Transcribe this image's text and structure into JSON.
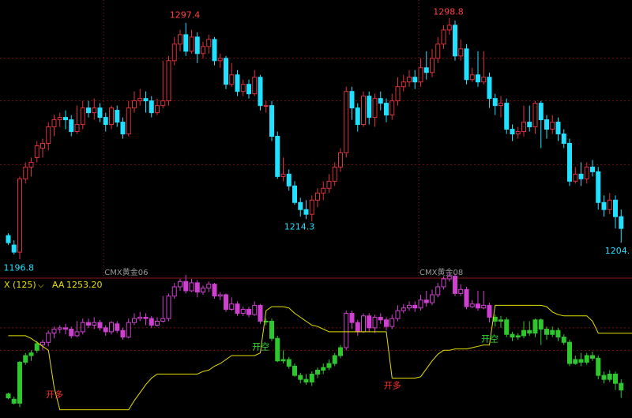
{
  "colors": {
    "background": "#000000",
    "up": "#e0303a",
    "down": "#22e0ff",
    "grid": "#7a1010",
    "separator": "#8b1a1a",
    "band_line": "#e6e000",
    "band_up": "#d040d0",
    "band_down": "#2ec82e",
    "label_high": "#ff4040",
    "label_low": "#22e0ff",
    "signal_long": "#2ee02e",
    "signal_short": "#ff3030",
    "indicator_title": "#e6e000"
  },
  "main": {
    "contract_labels": [
      {
        "text": "CMX黄金06",
        "index": 17
      },
      {
        "text": "CMX黄金08",
        "index": 72
      }
    ],
    "price_labels": [
      {
        "text": "1297.4",
        "index": 31,
        "price": 1297.4,
        "kind": "high"
      },
      {
        "text": "1214.3",
        "index": 51,
        "price": 1214.3,
        "kind": "low"
      },
      {
        "text": "1298.8",
        "index": 77,
        "price": 1298.8,
        "kind": "high"
      },
      {
        "text": "1196.8",
        "index": 2,
        "price": 1196.8,
        "kind": "low-left"
      },
      {
        "text": "1204.",
        "index": 107,
        "price": 1204.0,
        "kind": "low"
      }
    ]
  },
  "indicator": {
    "name": "X (125)",
    "line_label": "AA",
    "line_value": "1253.20",
    "signals": [
      {
        "text": "开空",
        "index": 44,
        "kind": "short"
      },
      {
        "text": "开多",
        "index": 67,
        "kind": "long"
      },
      {
        "text": "开空",
        "index": 84,
        "kind": "short"
      },
      {
        "text": "开多",
        "index": 8,
        "kind": "long"
      }
    ]
  },
  "chart_data": {
    "type": "candlestick",
    "ylim_price": [
      1192,
      1304
    ],
    "ylim_indicator": [
      1190,
      1285
    ],
    "gridlines_price": [
      1282,
      1264,
      1237
    ],
    "gridlines_indicator": [
      1257,
      1240
    ],
    "candles": [
      [
        1207,
        1204,
        1208,
        1203
      ],
      [
        1203,
        1200,
        1205,
        1199
      ],
      [
        1200,
        1231,
        1232,
        1197
      ],
      [
        1231,
        1236,
        1238,
        1229
      ],
      [
        1236,
        1238,
        1240,
        1232
      ],
      [
        1240,
        1245,
        1247,
        1238
      ],
      [
        1244,
        1246,
        1248,
        1240
      ],
      [
        1246,
        1253,
        1255,
        1243
      ],
      [
        1253,
        1256,
        1258,
        1249
      ],
      [
        1256,
        1257,
        1259,
        1253
      ],
      [
        1257,
        1256,
        1260,
        1252
      ],
      [
        1256,
        1251,
        1258,
        1249
      ],
      [
        1251,
        1254,
        1262,
        1250
      ],
      [
        1254,
        1261,
        1264,
        1252
      ],
      [
        1261,
        1259,
        1264,
        1257
      ],
      [
        1259,
        1261,
        1265,
        1256
      ],
      [
        1261,
        1257,
        1263,
        1255
      ],
      [
        1257,
        1254,
        1259,
        1251
      ],
      [
        1254,
        1261,
        1262,
        1252
      ],
      [
        1260,
        1255,
        1262,
        1253
      ],
      [
        1255,
        1250,
        1257,
        1248
      ],
      [
        1250,
        1261,
        1264,
        1249
      ],
      [
        1261,
        1264,
        1268,
        1259
      ],
      [
        1264,
        1265,
        1269,
        1262
      ],
      [
        1265,
        1264,
        1268,
        1259
      ],
      [
        1264,
        1259,
        1266,
        1257
      ],
      [
        1259,
        1262,
        1265,
        1258
      ],
      [
        1262,
        1264,
        1281,
        1261
      ],
      [
        1264,
        1281,
        1283,
        1262
      ],
      [
        1281,
        1288,
        1291,
        1279
      ],
      [
        1288,
        1292,
        1294,
        1285
      ],
      [
        1292,
        1285,
        1297,
        1283
      ],
      [
        1285,
        1291,
        1294,
        1284
      ],
      [
        1291,
        1284,
        1293,
        1280
      ],
      [
        1284,
        1287,
        1289,
        1282
      ],
      [
        1287,
        1290,
        1292,
        1284
      ],
      [
        1290,
        1281,
        1291,
        1279
      ],
      [
        1281,
        1282,
        1284,
        1278
      ],
      [
        1282,
        1271,
        1283,
        1269
      ],
      [
        1271,
        1275,
        1280,
        1270
      ],
      [
        1275,
        1268,
        1277,
        1266
      ],
      [
        1268,
        1271,
        1273,
        1266
      ],
      [
        1271,
        1267,
        1273,
        1265
      ],
      [
        1267,
        1274,
        1277,
        1266
      ],
      [
        1274,
        1262,
        1275,
        1260
      ],
      [
        1262,
        1262,
        1264,
        1259
      ],
      [
        1262,
        1249,
        1264,
        1247
      ],
      [
        1249,
        1232,
        1251,
        1231
      ],
      [
        1232,
        1233,
        1240,
        1230
      ],
      [
        1233,
        1228,
        1235,
        1226
      ],
      [
        1228,
        1221,
        1230,
        1220
      ],
      [
        1221,
        1218,
        1223,
        1215
      ],
      [
        1218,
        1216,
        1222,
        1214
      ],
      [
        1216,
        1222,
        1224,
        1213
      ],
      [
        1222,
        1225,
        1227,
        1219
      ],
      [
        1225,
        1227,
        1230,
        1222
      ],
      [
        1227,
        1230,
        1233,
        1225
      ],
      [
        1230,
        1236,
        1238,
        1228
      ],
      [
        1236,
        1242,
        1244,
        1234
      ],
      [
        1242,
        1268,
        1270,
        1240
      ],
      [
        1268,
        1261,
        1270,
        1256
      ],
      [
        1261,
        1254,
        1263,
        1251
      ],
      [
        1254,
        1266,
        1268,
        1253
      ],
      [
        1266,
        1257,
        1268,
        1254
      ],
      [
        1257,
        1265,
        1267,
        1253
      ],
      [
        1265,
        1263,
        1268,
        1260
      ],
      [
        1263,
        1258,
        1265,
        1255
      ],
      [
        1258,
        1264,
        1267,
        1256
      ],
      [
        1264,
        1270,
        1274,
        1262
      ],
      [
        1270,
        1272,
        1275,
        1268
      ],
      [
        1272,
        1274,
        1277,
        1270
      ],
      [
        1274,
        1272,
        1277,
        1269
      ],
      [
        1272,
        1278,
        1282,
        1270
      ],
      [
        1278,
        1276,
        1285,
        1273
      ],
      [
        1276,
        1282,
        1286,
        1274
      ],
      [
        1282,
        1288,
        1291,
        1280
      ],
      [
        1288,
        1294,
        1296,
        1286
      ],
      [
        1294,
        1296,
        1299,
        1292
      ],
      [
        1296,
        1283,
        1298,
        1281
      ],
      [
        1283,
        1286,
        1290,
        1281
      ],
      [
        1286,
        1273,
        1288,
        1271
      ],
      [
        1273,
        1275,
        1278,
        1272
      ],
      [
        1275,
        1272,
        1285,
        1270
      ],
      [
        1272,
        1274,
        1285,
        1271
      ],
      [
        1274,
        1265,
        1276,
        1261
      ],
      [
        1265,
        1262,
        1267,
        1258
      ],
      [
        1262,
        1263,
        1266,
        1257
      ],
      [
        1263,
        1252,
        1265,
        1250
      ],
      [
        1252,
        1250,
        1254,
        1247
      ],
      [
        1250,
        1251,
        1253,
        1248
      ],
      [
        1251,
        1255,
        1262,
        1249
      ],
      [
        1255,
        1253,
        1262,
        1251
      ],
      [
        1253,
        1263,
        1264,
        1250
      ],
      [
        1263,
        1256,
        1264,
        1244
      ],
      [
        1256,
        1252,
        1258,
        1248
      ],
      [
        1252,
        1255,
        1258,
        1250
      ],
      [
        1255,
        1250,
        1257,
        1247
      ],
      [
        1250,
        1246,
        1252,
        1244
      ],
      [
        1246,
        1230,
        1248,
        1228
      ],
      [
        1230,
        1233,
        1236,
        1229
      ],
      [
        1233,
        1231,
        1238,
        1228
      ],
      [
        1231,
        1236,
        1238,
        1229
      ],
      [
        1236,
        1234,
        1239,
        1232
      ],
      [
        1234,
        1221,
        1236,
        1218
      ],
      [
        1221,
        1218,
        1224,
        1215
      ],
      [
        1218,
        1222,
        1225,
        1216
      ],
      [
        1222,
        1215,
        1224,
        1210
      ],
      [
        1215,
        1210,
        1218,
        1204
      ]
    ],
    "indicator_line": [
      1251,
      1251,
      1251,
      1251,
      1249,
      1246,
      1243,
      1240,
      1212,
      1195,
      1195,
      1195,
      1195,
      1195,
      1195,
      1195,
      1195,
      1195,
      1195,
      1195,
      1195,
      1195,
      1202,
      1208,
      1214,
      1219,
      1222,
      1222,
      1222,
      1222,
      1222,
      1222,
      1222,
      1222,
      1224,
      1225,
      1228,
      1230,
      1233,
      1236,
      1236,
      1236,
      1236,
      1236,
      1238,
      1270,
      1273,
      1273,
      1273,
      1272,
      1268,
      1265,
      1262,
      1259,
      1258,
      1256,
      1254,
      1254,
      1254,
      1254,
      1254,
      1254,
      1254,
      1254,
      1254,
      1254,
      1254,
      1219,
      1219,
      1219,
      1219,
      1219,
      1220,
      1226,
      1232,
      1237,
      1240,
      1240,
      1241,
      1241,
      1241,
      1242,
      1243,
      1244,
      1244,
      1274,
      1274,
      1274,
      1274,
      1274,
      1274,
      1274,
      1274,
      1274,
      1273,
      1269,
      1267,
      1266,
      1266,
      1266,
      1266,
      1266,
      1262,
      1253,
      1253,
      1253,
      1253,
      1253,
      1253,
      1253,
      1253,
      1253
    ]
  }
}
